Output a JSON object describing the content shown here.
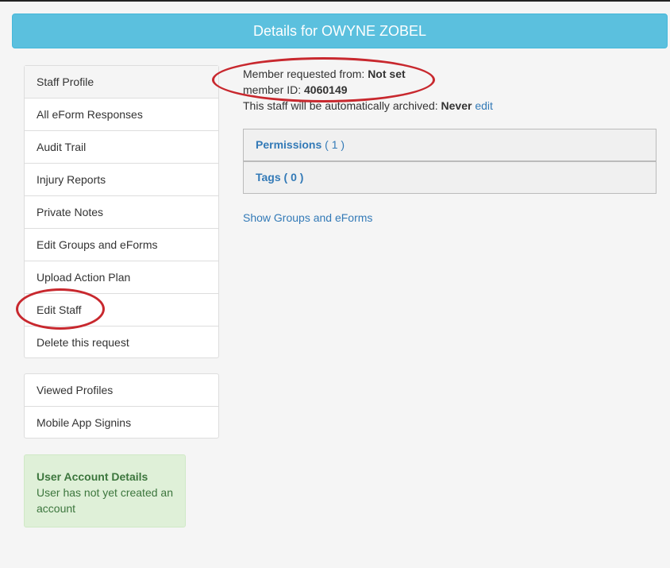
{
  "header": {
    "title": "Details for OWYNE ZOBEL"
  },
  "nav_primary": [
    {
      "label": "Staff Profile"
    },
    {
      "label": "All eForm Responses"
    },
    {
      "label": "Audit Trail"
    },
    {
      "label": "Injury Reports"
    },
    {
      "label": "Private Notes"
    },
    {
      "label": "Edit Groups and eForms"
    },
    {
      "label": "Upload Action Plan"
    },
    {
      "label": "Edit Staff"
    },
    {
      "label": "Delete this request"
    }
  ],
  "nav_secondary": [
    {
      "label": "Viewed Profiles"
    },
    {
      "label": "Mobile App Signins"
    }
  ],
  "account_box": {
    "title": "User Account Details",
    "message": "User has not yet created an account"
  },
  "info": {
    "requested_label": "Member requested from:",
    "requested_value": "Not set",
    "member_id_label": "member ID:",
    "member_id_value": "4060149",
    "archive_label": "This staff will be automatically archived:",
    "archive_value": "Never",
    "archive_edit": "edit"
  },
  "panels": {
    "permissions": {
      "label": "Permissions",
      "count": "( 1 )"
    },
    "tags": {
      "label": "Tags",
      "count": "( 0 )"
    }
  },
  "show_groups_link": "Show Groups and eForms",
  "colors": {
    "header_bg": "#5bc0de",
    "link": "#337ab7",
    "annotation": "#c8282e",
    "success_bg": "#dff0d8",
    "success_text": "#3c763d"
  }
}
